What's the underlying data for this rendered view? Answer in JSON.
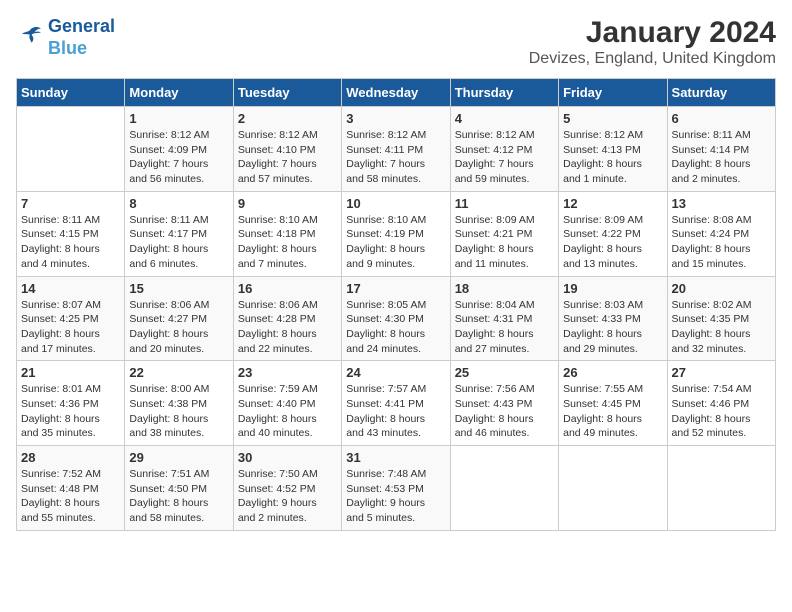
{
  "logo": {
    "line1": "General",
    "line2": "Blue"
  },
  "title": "January 2024",
  "subtitle": "Devizes, England, United Kingdom",
  "days": [
    "Sunday",
    "Monday",
    "Tuesday",
    "Wednesday",
    "Thursday",
    "Friday",
    "Saturday"
  ],
  "weeks": [
    [
      {
        "date": "",
        "info": ""
      },
      {
        "date": "1",
        "info": "Sunrise: 8:12 AM\nSunset: 4:09 PM\nDaylight: 7 hours\nand 56 minutes."
      },
      {
        "date": "2",
        "info": "Sunrise: 8:12 AM\nSunset: 4:10 PM\nDaylight: 7 hours\nand 57 minutes."
      },
      {
        "date": "3",
        "info": "Sunrise: 8:12 AM\nSunset: 4:11 PM\nDaylight: 7 hours\nand 58 minutes."
      },
      {
        "date": "4",
        "info": "Sunrise: 8:12 AM\nSunset: 4:12 PM\nDaylight: 7 hours\nand 59 minutes."
      },
      {
        "date": "5",
        "info": "Sunrise: 8:12 AM\nSunset: 4:13 PM\nDaylight: 8 hours\nand 1 minute."
      },
      {
        "date": "6",
        "info": "Sunrise: 8:11 AM\nSunset: 4:14 PM\nDaylight: 8 hours\nand 2 minutes."
      }
    ],
    [
      {
        "date": "7",
        "info": "Sunrise: 8:11 AM\nSunset: 4:15 PM\nDaylight: 8 hours\nand 4 minutes."
      },
      {
        "date": "8",
        "info": "Sunrise: 8:11 AM\nSunset: 4:17 PM\nDaylight: 8 hours\nand 6 minutes."
      },
      {
        "date": "9",
        "info": "Sunrise: 8:10 AM\nSunset: 4:18 PM\nDaylight: 8 hours\nand 7 minutes."
      },
      {
        "date": "10",
        "info": "Sunrise: 8:10 AM\nSunset: 4:19 PM\nDaylight: 8 hours\nand 9 minutes."
      },
      {
        "date": "11",
        "info": "Sunrise: 8:09 AM\nSunset: 4:21 PM\nDaylight: 8 hours\nand 11 minutes."
      },
      {
        "date": "12",
        "info": "Sunrise: 8:09 AM\nSunset: 4:22 PM\nDaylight: 8 hours\nand 13 minutes."
      },
      {
        "date": "13",
        "info": "Sunrise: 8:08 AM\nSunset: 4:24 PM\nDaylight: 8 hours\nand 15 minutes."
      }
    ],
    [
      {
        "date": "14",
        "info": "Sunrise: 8:07 AM\nSunset: 4:25 PM\nDaylight: 8 hours\nand 17 minutes."
      },
      {
        "date": "15",
        "info": "Sunrise: 8:06 AM\nSunset: 4:27 PM\nDaylight: 8 hours\nand 20 minutes."
      },
      {
        "date": "16",
        "info": "Sunrise: 8:06 AM\nSunset: 4:28 PM\nDaylight: 8 hours\nand 22 minutes."
      },
      {
        "date": "17",
        "info": "Sunrise: 8:05 AM\nSunset: 4:30 PM\nDaylight: 8 hours\nand 24 minutes."
      },
      {
        "date": "18",
        "info": "Sunrise: 8:04 AM\nSunset: 4:31 PM\nDaylight: 8 hours\nand 27 minutes."
      },
      {
        "date": "19",
        "info": "Sunrise: 8:03 AM\nSunset: 4:33 PM\nDaylight: 8 hours\nand 29 minutes."
      },
      {
        "date": "20",
        "info": "Sunrise: 8:02 AM\nSunset: 4:35 PM\nDaylight: 8 hours\nand 32 minutes."
      }
    ],
    [
      {
        "date": "21",
        "info": "Sunrise: 8:01 AM\nSunset: 4:36 PM\nDaylight: 8 hours\nand 35 minutes."
      },
      {
        "date": "22",
        "info": "Sunrise: 8:00 AM\nSunset: 4:38 PM\nDaylight: 8 hours\nand 38 minutes."
      },
      {
        "date": "23",
        "info": "Sunrise: 7:59 AM\nSunset: 4:40 PM\nDaylight: 8 hours\nand 40 minutes."
      },
      {
        "date": "24",
        "info": "Sunrise: 7:57 AM\nSunset: 4:41 PM\nDaylight: 8 hours\nand 43 minutes."
      },
      {
        "date": "25",
        "info": "Sunrise: 7:56 AM\nSunset: 4:43 PM\nDaylight: 8 hours\nand 46 minutes."
      },
      {
        "date": "26",
        "info": "Sunrise: 7:55 AM\nSunset: 4:45 PM\nDaylight: 8 hours\nand 49 minutes."
      },
      {
        "date": "27",
        "info": "Sunrise: 7:54 AM\nSunset: 4:46 PM\nDaylight: 8 hours\nand 52 minutes."
      }
    ],
    [
      {
        "date": "28",
        "info": "Sunrise: 7:52 AM\nSunset: 4:48 PM\nDaylight: 8 hours\nand 55 minutes."
      },
      {
        "date": "29",
        "info": "Sunrise: 7:51 AM\nSunset: 4:50 PM\nDaylight: 8 hours\nand 58 minutes."
      },
      {
        "date": "30",
        "info": "Sunrise: 7:50 AM\nSunset: 4:52 PM\nDaylight: 9 hours\nand 2 minutes."
      },
      {
        "date": "31",
        "info": "Sunrise: 7:48 AM\nSunset: 4:53 PM\nDaylight: 9 hours\nand 5 minutes."
      },
      {
        "date": "",
        "info": ""
      },
      {
        "date": "",
        "info": ""
      },
      {
        "date": "",
        "info": ""
      }
    ]
  ]
}
